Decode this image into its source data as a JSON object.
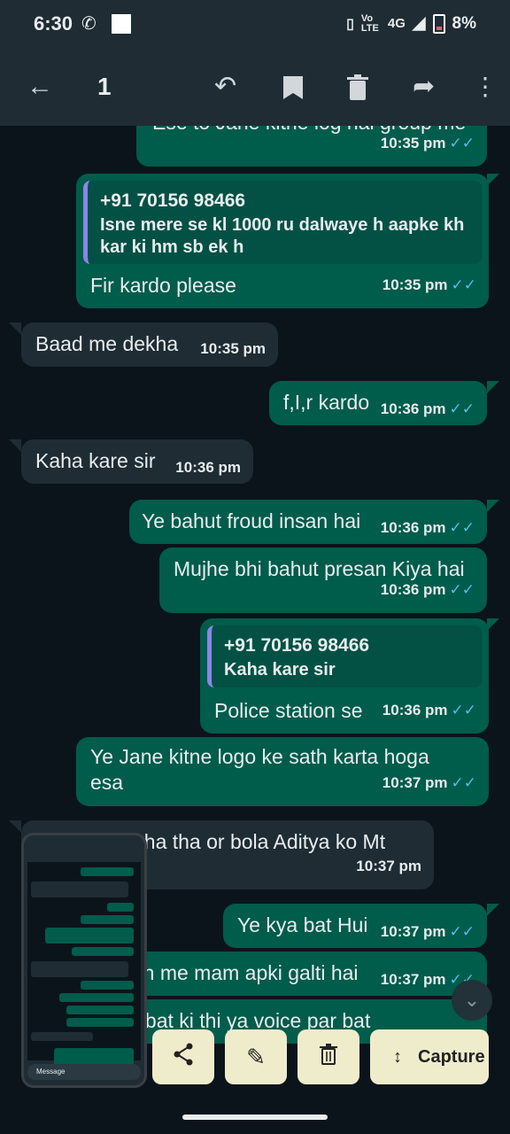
{
  "status_bar": {
    "time": "6:30",
    "network": "4G",
    "volte": "Vo LTE",
    "battery": "8%"
  },
  "app_bar": {
    "selected_count": "1",
    "icons": [
      "back-arrow-icon",
      "reply-icon",
      "bookmark-icon",
      "delete-icon",
      "forward-icon",
      "more-vert-icon"
    ]
  },
  "messages": [
    {
      "dir": "out",
      "text": "Ese to Jane kitne log hai group me",
      "time": "10:35 pm"
    },
    {
      "dir": "out",
      "quote_name": "+91 70156 98466",
      "quote_text": "Isne mere se kl 1000 ru dalwaye h aapke kh kar ki hm sb ek h",
      "text": "Fir kardo please",
      "time": "10:35 pm"
    },
    {
      "dir": "in",
      "text": "Baad me dekha",
      "time": "10:35 pm"
    },
    {
      "dir": "out",
      "text": "f,I,r kardo",
      "time": "10:36 pm"
    },
    {
      "dir": "in",
      "text": "Kaha kare sir",
      "time": "10:36 pm"
    },
    {
      "dir": "out",
      "text": "Ye bahut froud insan hai",
      "time": "10:36 pm"
    },
    {
      "dir": "out",
      "text": "Mujhe bhi bahut presan Kiya hai",
      "time": "10:36 pm"
    },
    {
      "dir": "out",
      "quote_name": "+91 70156 98466",
      "quote_text": "Kaha kare sir",
      "text": "Police station se",
      "time": "10:36 pm"
    },
    {
      "dir": "out",
      "text": "Ye Jane kitne logo ke sath karta hoga esa",
      "time": "10:37 pm"
    },
    {
      "dir": "in",
      "text": "500 lene Paha tha or bola Aditya ko Mt",
      "time": "10:37 pm"
    },
    {
      "dir": "out",
      "text": "Ye kya bat Hui",
      "time": "10:37 pm"
    },
    {
      "dir": "out",
      "text": "Sach me mam apki galti hai",
      "time": "10:37 pm"
    },
    {
      "dir": "out",
      "text": "Mene bat ki thi ya voice par bat",
      "time": ""
    }
  ],
  "thumbnail": {
    "input_placeholder": "Message"
  },
  "screenshot_toolbar": {
    "capture_label": "Capture",
    "icons": [
      "share-icon",
      "edit-icon",
      "delete-icon",
      "expand-icon"
    ]
  },
  "colors": {
    "outgoing": "#005c4b",
    "incoming": "#1f2c34",
    "background": "#0b141a",
    "tick": "#53bdeb",
    "toolbar_button": "#efeccb"
  }
}
